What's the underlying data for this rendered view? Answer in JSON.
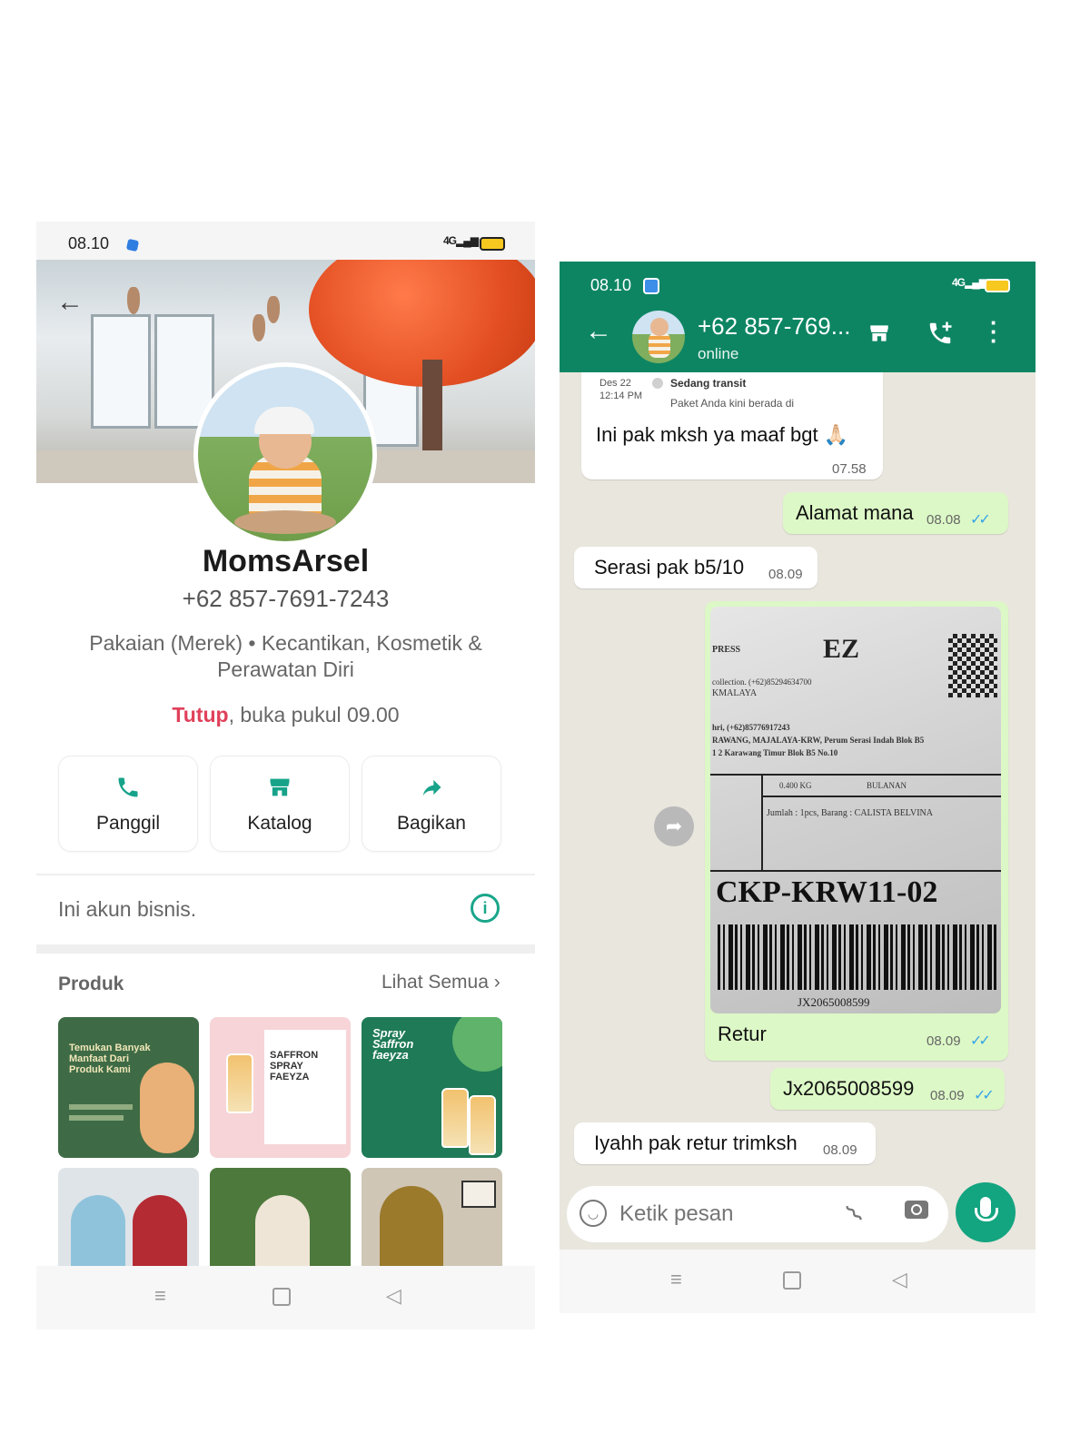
{
  "left": {
    "status": {
      "time": "08.10",
      "signal": "4G"
    },
    "profile": {
      "name": "MomsArsel",
      "phone": "+62 857-7691-7243",
      "category": "Pakaian (Merek) • Kecantikan, Kosmetik & Perawatan Diri",
      "hours_closed": "Tutup",
      "hours_rest": ", buka pukul 09.00"
    },
    "actions": [
      {
        "label": "Panggil",
        "icon": "phone-icon"
      },
      {
        "label": "Katalog",
        "icon": "store-icon"
      },
      {
        "label": "Bagikan",
        "icon": "share-icon"
      }
    ],
    "business_note": "Ini akun bisnis.",
    "products": {
      "title": "Produk",
      "see_all": "Lihat Semua",
      "tiles": [
        {
          "text": "Temukan Banyak Manfaat Dari Produk Kami",
          "color": "#3e6b45"
        },
        {
          "text": "SAFFRON SPRAY FAEYZA",
          "color": "#f6d4d7"
        },
        {
          "text": "Spray Saffron faeyza",
          "color": "#1f7a57"
        }
      ]
    }
  },
  "right": {
    "status": {
      "time": "08.10",
      "signal": "4G"
    },
    "header": {
      "title": "+62 857-769...",
      "status": "online"
    },
    "quoted": {
      "date": "Des 22",
      "time": "12:14 PM",
      "state": "Sedang transit",
      "detail": "Paket Anda kini berada di"
    },
    "messages": [
      {
        "text": "Ini pak mksh ya maaf bgt 🙏🏻",
        "time": "07.58",
        "dir": "in"
      },
      {
        "text": "Alamat mana",
        "time": "08.08",
        "dir": "out"
      },
      {
        "text": "Serasi pak b5/10",
        "time": "08.09",
        "dir": "in"
      },
      {
        "text": "Retur",
        "time": "08.09",
        "dir": "out"
      },
      {
        "text": "Jx2065008599",
        "time": "08.09",
        "dir": "out"
      },
      {
        "text": "Iyahh pak retur trimksh",
        "time": "08.09",
        "dir": "in"
      }
    ],
    "label_photo": {
      "brand": "EZ",
      "line1": "PRESS",
      "line2": "collection. (+62)85294634700",
      "line3": "KMALAYA",
      "line4": "hri, (+62)85776917243",
      "line5": "RAWANG, MAJALAYA-KRW, Perum Serasi Indah Blok B5",
      "line6": "1 2 Karawang Timur Blok B5 No.10",
      "weight": "0.400 KG",
      "period": "BULANAN",
      "items": "Jumlah : 1pcs, Barang : CALISTA BELVINA",
      "code": "CKP-KRW11-02",
      "tracking": "JX2065008599"
    },
    "composer": {
      "placeholder": "Ketik pesan"
    }
  }
}
